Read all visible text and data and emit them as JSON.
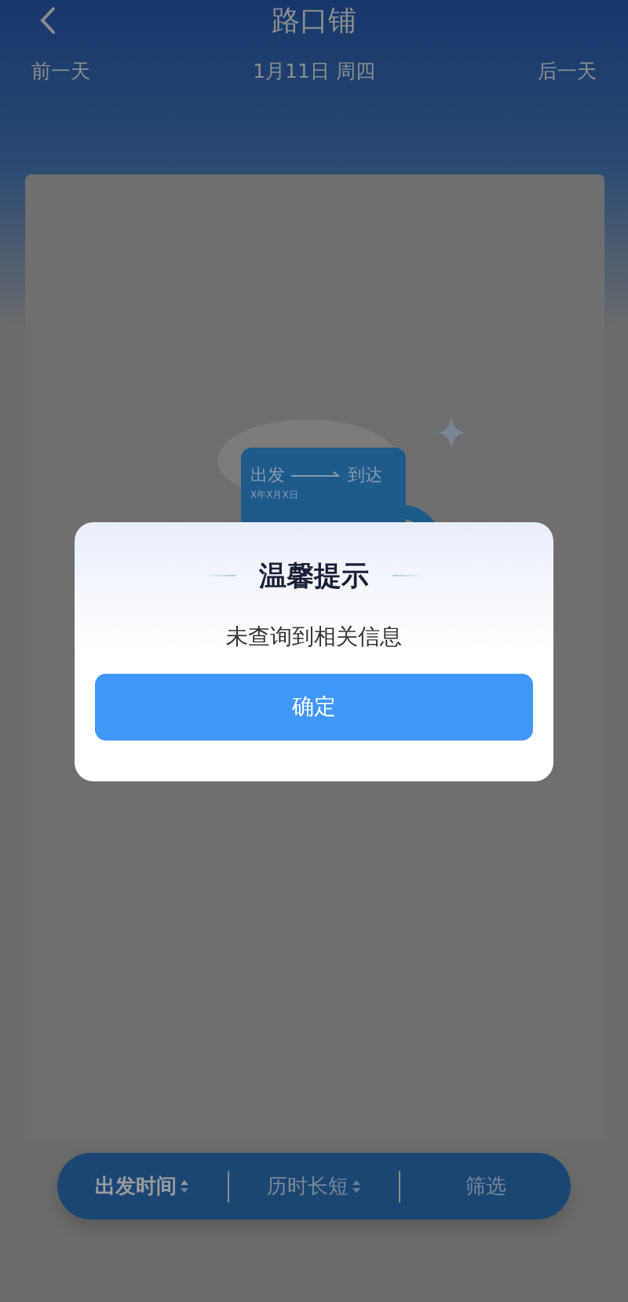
{
  "header": {
    "title": "路口铺",
    "prev_day": "前一天",
    "date": "1月11日 周四",
    "next_day": "后一天"
  },
  "illustration": {
    "depart": "出发",
    "arrive": "到达",
    "date_text": "X年X月X日"
  },
  "sort_bar": [
    {
      "label": "出发时间",
      "kind": "sort",
      "selected": true
    },
    {
      "label": "历时长短",
      "kind": "sort",
      "selected": false
    },
    {
      "label": "筛选",
      "kind": "filter",
      "selected": false
    }
  ],
  "dialog": {
    "title": "温馨提示",
    "message": "未查询到相关信息",
    "button": "确定"
  }
}
